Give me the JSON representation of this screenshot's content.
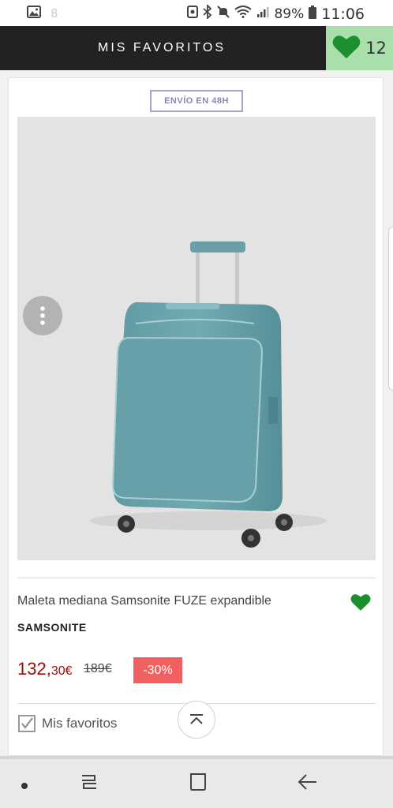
{
  "status_bar": {
    "notification_count": "8",
    "battery_percent": "89%",
    "time": "11:06"
  },
  "header": {
    "title": "MIS FAVORITOS",
    "favorites_count": "12"
  },
  "product": {
    "badge": "ENVÍO EN 48H",
    "name": "Maleta mediana Samsonite FUZE expandible",
    "brand": "SAMSONITE",
    "price_main": "132,",
    "price_cents": "30€",
    "old_price": "189€",
    "discount": "-30%",
    "favorites_label": "Mis favoritos"
  },
  "colors": {
    "accent_green": "#1c8f2e",
    "fav_box": "#a9dfaa",
    "price_red": "#a10b0b",
    "discount_bg": "#f06060",
    "header_bg": "#222222",
    "luggage": "#6ea5ad"
  },
  "icons": {
    "status_left": [
      "image-icon"
    ],
    "status_right": [
      "nfc-icon",
      "bluetooth-icon",
      "mute-icon",
      "wifi-icon",
      "signal-icon",
      "battery-icon"
    ],
    "nav": [
      "recent-apps-dot-icon",
      "recents-icon",
      "home-icon",
      "back-icon"
    ]
  }
}
